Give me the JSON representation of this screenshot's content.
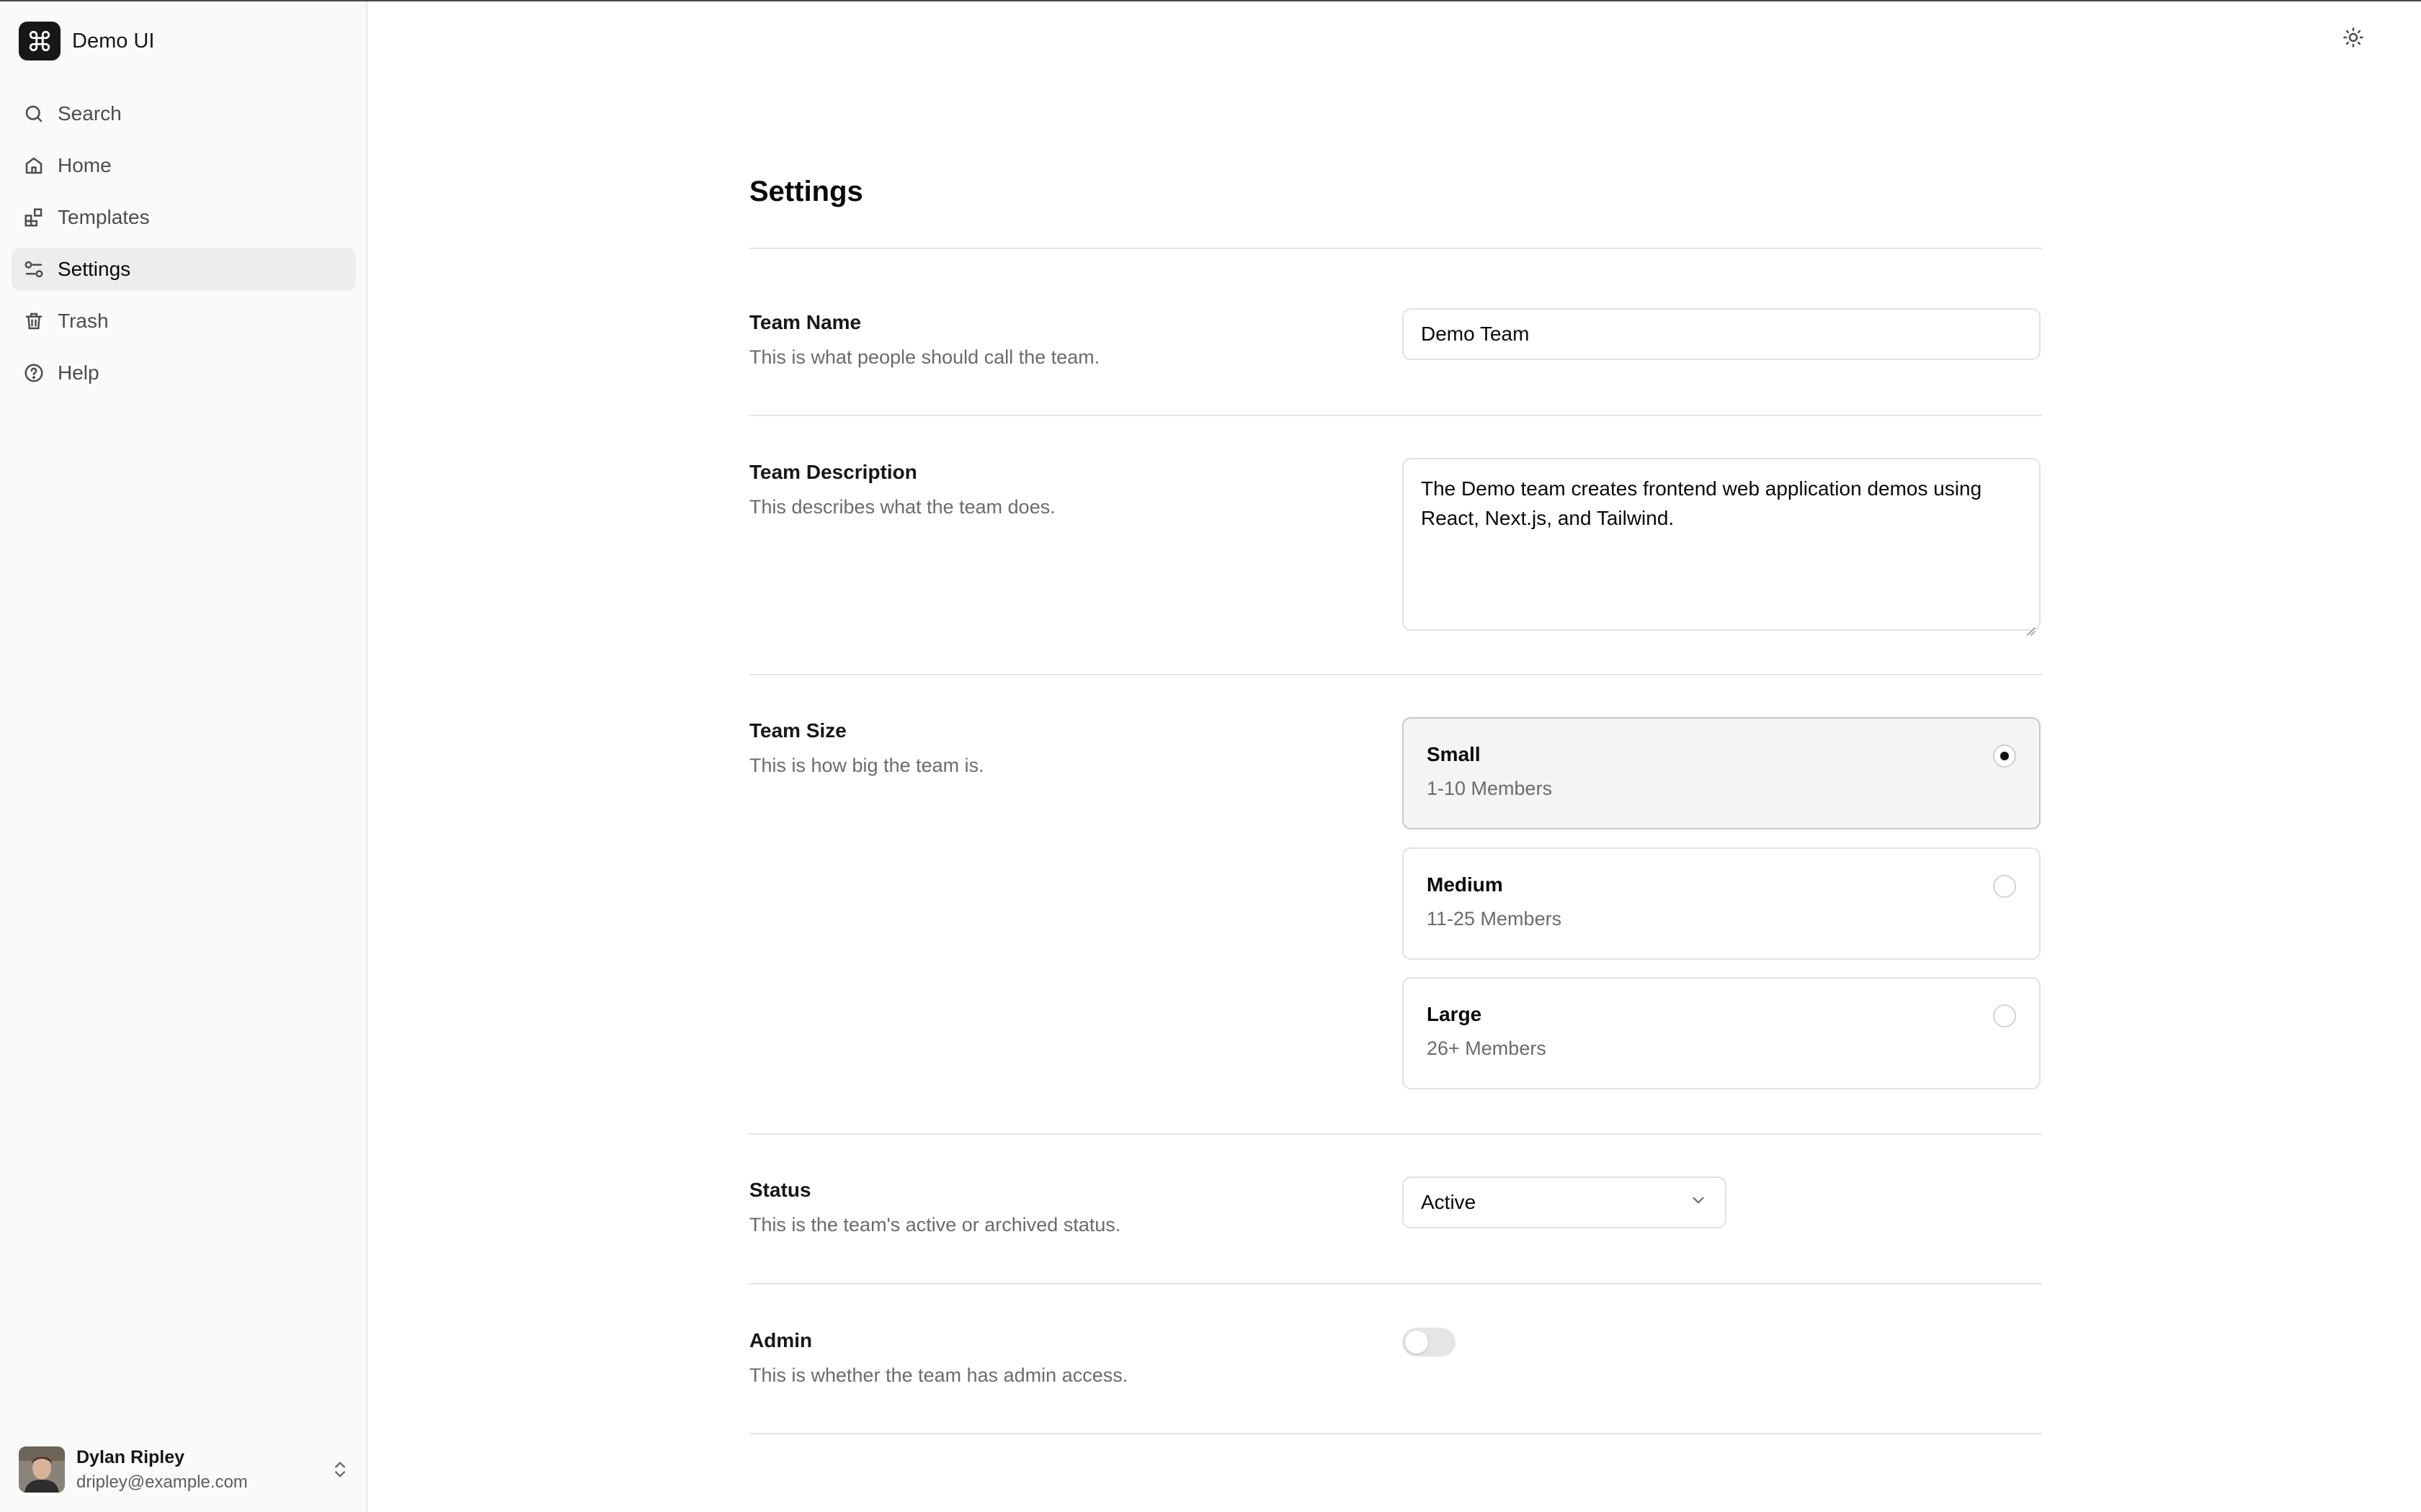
{
  "app": {
    "name": "Demo UI"
  },
  "sidebar": {
    "items": [
      {
        "label": "Search",
        "icon": "search-icon"
      },
      {
        "label": "Home",
        "icon": "home-icon"
      },
      {
        "label": "Templates",
        "icon": "templates-icon"
      },
      {
        "label": "Settings",
        "icon": "settings-sliders-icon",
        "active": true
      },
      {
        "label": "Trash",
        "icon": "trash-icon"
      },
      {
        "label": "Help",
        "icon": "help-icon"
      }
    ]
  },
  "user": {
    "name": "Dylan Ripley",
    "email": "dripley@example.com"
  },
  "page": {
    "title": "Settings"
  },
  "settings": {
    "team_name": {
      "label": "Team Name",
      "description": "This is what people should call the team.",
      "value": "Demo Team"
    },
    "team_description": {
      "label": "Team Description",
      "description": "This describes what the team does.",
      "value": "The Demo team creates frontend web application demos using React, Next.js, and Tailwind."
    },
    "team_size": {
      "label": "Team Size",
      "description": "This is how big the team is.",
      "options": [
        {
          "title": "Small",
          "subtitle": "1-10 Members",
          "selected": true
        },
        {
          "title": "Medium",
          "subtitle": "11-25 Members",
          "selected": false
        },
        {
          "title": "Large",
          "subtitle": "26+ Members",
          "selected": false
        }
      ]
    },
    "status": {
      "label": "Status",
      "description": "This is the team's active or archived status.",
      "value": "Active"
    },
    "admin": {
      "label": "Admin",
      "description": "This is whether the team has admin access.",
      "enabled": false
    }
  },
  "colors": {
    "accent": "#171717",
    "sidebar_bg": "#fafafa",
    "active_item_bg": "#ededed"
  }
}
